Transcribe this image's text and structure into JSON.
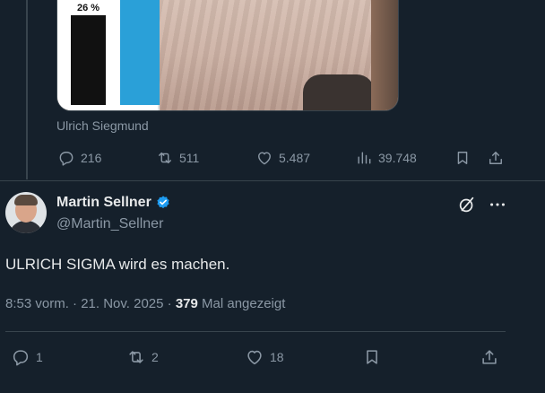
{
  "quoted_media": {
    "chart_label": "26 %",
    "caption": "Ulrich Siegmund"
  },
  "previous_tweet_actions": {
    "replies": "216",
    "reposts": "511",
    "likes": "5.487",
    "views": "39.748"
  },
  "tweet": {
    "display_name": "Martin Sellner",
    "handle": "@Martin_Sellner",
    "text": "ULRICH SIGMA wird es machen.",
    "time": "8:53 vorm. · 21. Nov. 2025 · ",
    "view_count": "379",
    "view_suffix": " Mal angezeigt"
  },
  "tweet_actions": {
    "replies": "1",
    "reposts": "2",
    "likes": "18"
  },
  "colors": {
    "background": "#15202b",
    "text_primary": "#e7e9ea",
    "text_secondary": "#8b98a5",
    "verified": "#1d9bf0",
    "border": "#38444d"
  },
  "icons": [
    "reply-icon",
    "repost-icon",
    "like-icon",
    "views-icon",
    "bookmark-icon",
    "share-icon",
    "verified-badge-icon",
    "grok-icon",
    "more-icon"
  ]
}
